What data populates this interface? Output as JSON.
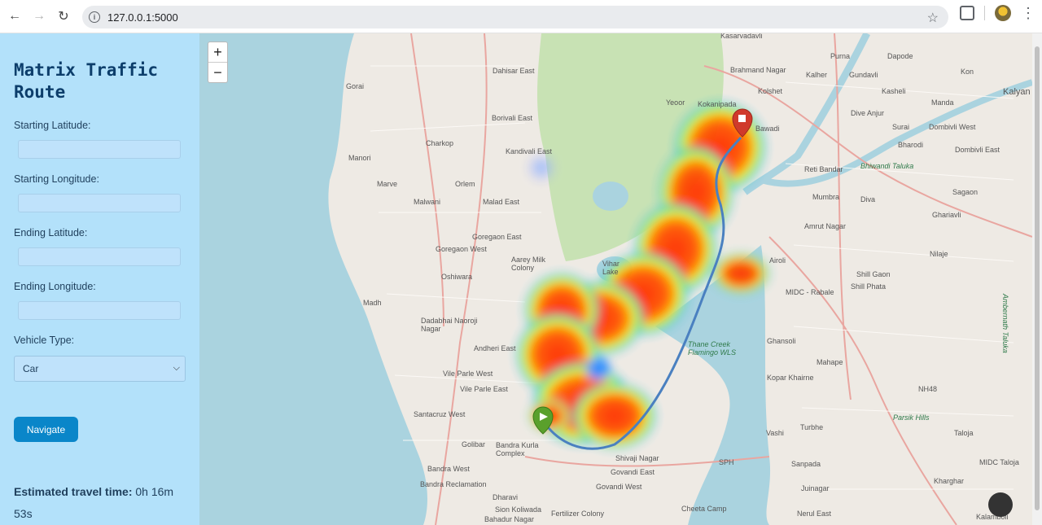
{
  "browser": {
    "url": "127.0.0.1:5000",
    "icons": [
      "back-arrow-icon",
      "forward-arrow-icon",
      "reload-icon",
      "info-icon",
      "star-icon",
      "puzzle-icon",
      "profile-icon",
      "menu-icon"
    ]
  },
  "sidebar": {
    "title": "Matrix Traffic Route",
    "fields": {
      "start_lat_label": "Starting Latitude:",
      "start_lon_label": "Starting Longitude:",
      "end_lat_label": "Ending Latitude:",
      "end_lon_label": "Ending Longitude:",
      "start_lat_value": "",
      "start_lon_value": "",
      "end_lat_value": "",
      "end_lon_value": ""
    },
    "vehicle_label": "Vehicle Type:",
    "vehicle_selected": "Car",
    "navigate_label": "Navigate",
    "travel_time_label": "Estimated travel time:",
    "travel_time_value": "0h 16m 53s"
  },
  "map": {
    "zoom_in": "+",
    "zoom_out": "−",
    "places": [
      "Kasarvadavli",
      "Brahmand Nagar",
      "Kolshet",
      "Purna",
      "Dapode",
      "Kon",
      "Kalyan",
      "Kalher",
      "Gundavli",
      "Kasheli",
      "Manda",
      "Dahisar East",
      "Gorai",
      "Borivali East",
      "Kokanipada",
      "Yeoor",
      "Bawadi",
      "Dive Anjur",
      "Surai",
      "Dombivli West",
      "Bharodi",
      "Dombivli East",
      "Charkop",
      "Kandivali East",
      "Manori",
      "Marve",
      "Orlem",
      "Malwani",
      "Malad East",
      "Reti Bandar",
      "Bhiwandi Taluka",
      "Mumbra",
      "Diva",
      "Sagaon",
      "Ghariavli",
      "Goregaon East",
      "Amrut Nagar",
      "Goregaon West",
      "Aarey Milk Colony",
      "Vihar Lake",
      "Oshiwara",
      "Airoli",
      "Nilaje",
      "Shill Gaon",
      "Shill Phata",
      "MIDC - Rabale",
      "Madh",
      "Dadabhai Naoroji Nagar",
      "Andheri East",
      "Ghansoli",
      "Mahape",
      "Thane Creek Flamingo WLS",
      "Kopar Khairne",
      "Vile Parle West",
      "Vile Parle East",
      "NH48",
      "Santacruz West",
      "Parsik Hills",
      "Golibar",
      "Bandra Kurla Complex",
      "Vashi",
      "Turbhe",
      "Shivaji Nagar",
      "Taloja",
      "Bandra West",
      "Govandi East",
      "SPH",
      "Sanpada",
      "Kharghar",
      "MIDC Taloja",
      "Bandra Reclamation",
      "Govandi West",
      "Juinagar",
      "Dharavi",
      "Cheeta Camp",
      "Sion Koliwada",
      "Fertilizer Colony",
      "Nerul East",
      "Bahadur Nagar",
      "Kalamboli",
      "Ambernath Taluka"
    ]
  }
}
